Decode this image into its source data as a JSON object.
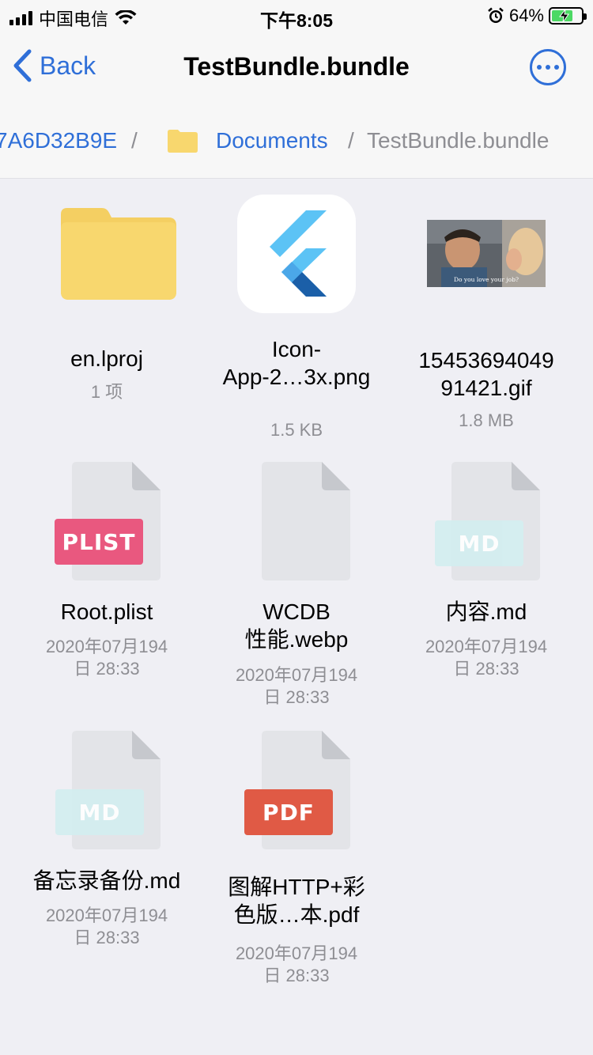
{
  "status_bar": {
    "carrier": "中国电信",
    "time": "下午8:05",
    "battery": "64%"
  },
  "nav": {
    "back_label": "Back",
    "title": "TestBundle.bundle"
  },
  "breadcrumb": {
    "parent_id": "7A6D32B9E",
    "separator": "/",
    "folder": "Documents",
    "current": "TestBundle.bundle"
  },
  "items": [
    {
      "name": "en.lproj",
      "meta": "1 项",
      "icon": "folder-icon"
    },
    {
      "name": "Icon-\nApp-2…3x.png",
      "name_line1": "Icon-",
      "name_line2": "App-2…3x.png",
      "meta": "1.5 KB",
      "icon": "flutter-app-icon"
    },
    {
      "name_line1": "15453694049",
      "name_line2": "91421.gif",
      "meta": "1.8 MB",
      "icon": "gif-thumbnail",
      "gif_caption": "Do you love your job?"
    },
    {
      "name": "Root.plist",
      "meta_line1": "2020年07月194",
      "meta_line2": "日 28:33",
      "icon": "plist-file-icon",
      "badge": "PLIST",
      "badge_color": "#E9587F"
    },
    {
      "name_line1": "WCDB",
      "name_line2": "性能.webp",
      "meta_line1": "2020年07月194",
      "meta_line2": "日 28:33",
      "icon": "generic-file-icon"
    },
    {
      "name": "内容.md",
      "meta_line1": "2020年07月194",
      "meta_line2": "日 28:33",
      "icon": "md-file-icon",
      "badge": "MD",
      "badge_color": "#D4EEF0"
    },
    {
      "name": "备忘录备份.md",
      "meta_line1": "2020年07月194",
      "meta_line2": "日 28:33",
      "icon": "md-file-icon",
      "badge": "MD",
      "badge_color": "#D4EEF0"
    },
    {
      "name_line1": "图解HTTP+彩",
      "name_line2": "色版…本.pdf",
      "meta_line1": "2020年07月194",
      "meta_line2": "日 28:33",
      "icon": "pdf-file-icon",
      "badge": "PDF",
      "badge_color": "#E05A45"
    }
  ],
  "colors": {
    "accent": "#2F6FD8",
    "background": "#EFEFF4",
    "folder": "#F8D76E"
  }
}
